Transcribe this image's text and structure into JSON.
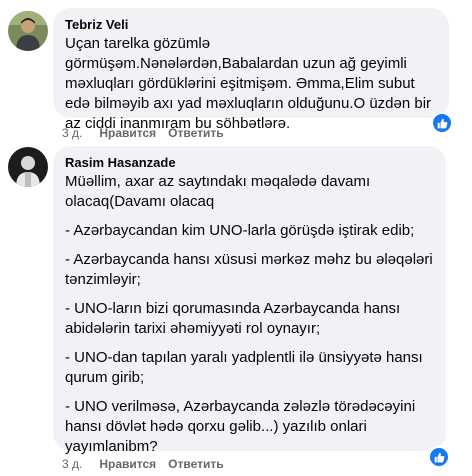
{
  "comments": [
    {
      "author": "Tebriz Veli",
      "paragraphs": [
        "Uçan tarelka gözümlə görmüşəm.Nənələrdən,Babalardan uzun ağ geyimli məxluqları gördüklərini eşitmişəm. Əmma,Elim subut edə bilməyib axı yad məxluqların olduğunu.O üzdən bir az ciddi inanmıram bu söhbətlərə."
      ],
      "age": "3 д.",
      "like_label": "Нравится",
      "reply_label": "Ответить",
      "reaction_icon": "like-icon"
    },
    {
      "author": "Rasim Hasanzade",
      "paragraphs": [
        "Müəllim, axar az saytındakı məqalədə davamı olacaq(Davamı olacaq",
        "- Azərbaycandan kim UNO-larla görüşdə iştirak edib;",
        "- Azərbaycanda hansı xüsusi mərkəz məhz bu ələqələri tənzimləyir;",
        "- UNO-ların bizi qorumasında Azərbaycanda hansı abidələrin tarixi əhəmiyyəti rol oynayır;",
        "- UNO-dan tapılan yaralı yadplentli ilə ünsiyyətə hansı qurum girib;",
        "- UNO verilməsə, Azərbaycanda zələzlə törədəcəyini hansı dövlət hədə qorxu gəlib...) yazılıb onlari yayımlanibm?"
      ],
      "age": "3 д.",
      "like_label": "Нравится",
      "reply_label": "Ответить",
      "reaction_icon": "like-icon"
    }
  ],
  "colors": {
    "bubble": "#f0f2f5",
    "meta_text": "#65676b",
    "like_blue": "#1877f2"
  }
}
